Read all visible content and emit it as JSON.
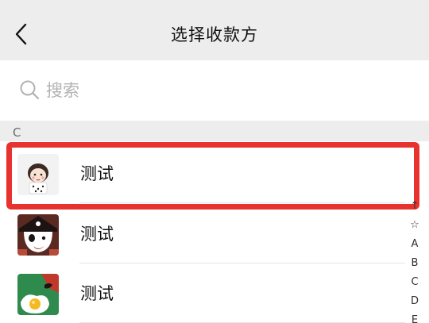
{
  "header": {
    "title": "选择收款方"
  },
  "search": {
    "placeholder": "搜索",
    "value": ""
  },
  "sections": [
    {
      "letter": "C",
      "contacts": [
        {
          "name": "测试",
          "avatar": "girl-cartoon-avatar",
          "selected": true
        },
        {
          "name": "测试",
          "avatar": "pirate-cartoon-avatar",
          "selected": false
        },
        {
          "name": "测试",
          "avatar": "egg-cartoon-avatar",
          "selected": false
        }
      ]
    }
  ],
  "index_bar": [
    "↑",
    "☆",
    "A",
    "B",
    "C",
    "D",
    "E"
  ],
  "colors": {
    "header_bg": "#ededed",
    "highlight": "#e8322f",
    "divider": "#e6e6e6",
    "text": "#111111",
    "placeholder": "#b2b2b2"
  }
}
